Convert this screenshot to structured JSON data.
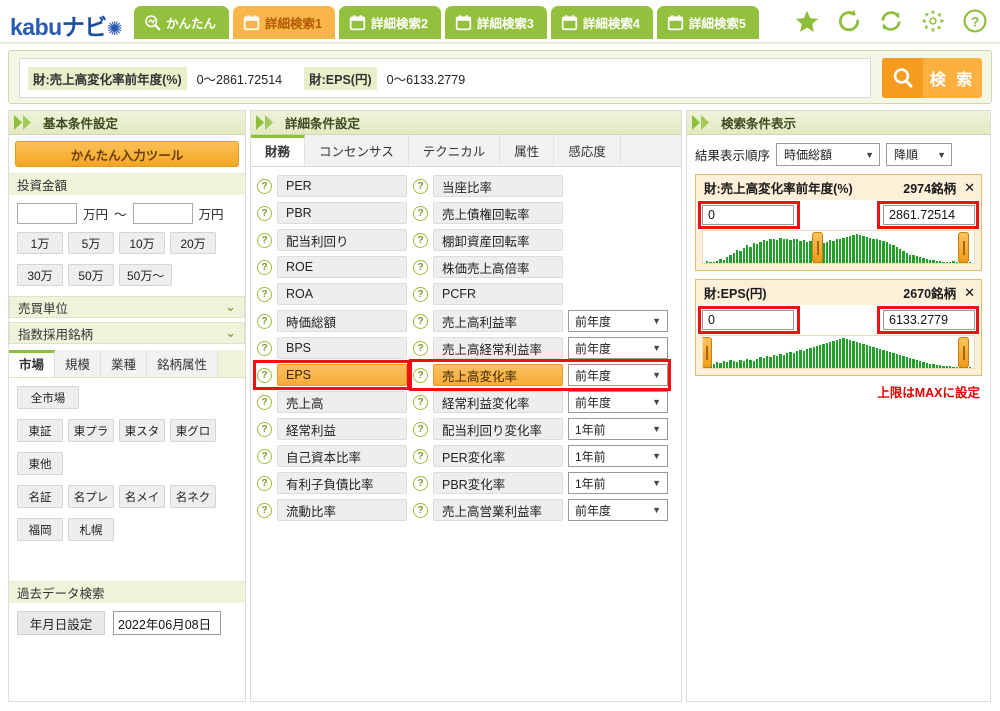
{
  "header": {
    "logo_kabu": "kabu",
    "logo_navi": "ナビ",
    "logo_mark": "✺",
    "tabs": [
      {
        "label": "かんたん",
        "icon": "search-chart-icon",
        "active": false
      },
      {
        "label": "詳細検索1",
        "icon": "calendar-icon",
        "active": true
      },
      {
        "label": "詳細検索2",
        "icon": "calendar-icon",
        "active": false
      },
      {
        "label": "詳細検索3",
        "icon": "calendar-icon",
        "active": false
      },
      {
        "label": "詳細検索4",
        "icon": "calendar-icon",
        "active": false
      },
      {
        "label": "詳細検索5",
        "icon": "calendar-icon",
        "active": false
      }
    ],
    "icons": [
      {
        "name": "star-icon",
        "glyph": "★"
      },
      {
        "name": "refresh-icon",
        "glyph": "⟳"
      },
      {
        "name": "sync-icon",
        "glyph": "⟲"
      },
      {
        "name": "gear-icon",
        "glyph": "✷"
      },
      {
        "name": "help-icon",
        "glyph": "?"
      }
    ],
    "accent_green": "#93c13d",
    "accent_orange": "#f9b648"
  },
  "searchbar": {
    "conditions": [
      {
        "chip": "財:売上高変化率前年度(%)",
        "value": "0〜2861.72514"
      },
      {
        "chip": "財:EPS(円)",
        "value": "0〜6133.2779"
      }
    ],
    "search_button": "検 索",
    "search_icon": "magnifier-icon"
  },
  "left_panel": {
    "title": "基本条件設定",
    "easy_tool_button": "かんたん入力ツール",
    "investment": {
      "label": "投資金額",
      "from_value": "",
      "to_value": "",
      "from_placeholder": "",
      "to_placeholder": "",
      "unit": "万円",
      "range_mark": "〜",
      "presets": [
        "1万",
        "5万",
        "10万",
        "20万",
        "30万",
        "50万",
        "50万〜"
      ]
    },
    "collapsibles": [
      {
        "label": "売買単位",
        "caret": "⌄"
      },
      {
        "label": "指数採用銘柄",
        "caret": "⌄"
      }
    ],
    "market_tabs": [
      {
        "label": "市場",
        "active": true
      },
      {
        "label": "規模",
        "active": false
      },
      {
        "label": "業種",
        "active": false
      },
      {
        "label": "銘柄属性",
        "active": false
      }
    ],
    "markets_row1": [
      "全市場"
    ],
    "markets_row2": [
      "東証",
      "東プラ",
      "東スタ",
      "東グロ"
    ],
    "markets_row3": [
      "東他"
    ],
    "markets_row4": [
      "名証",
      "名プレ",
      "名メイ",
      "名ネク"
    ],
    "markets_row5": [
      "福岡",
      "札幌"
    ],
    "past_data": {
      "label": "過去データ検索",
      "date_button": "年月日設定",
      "date_value": "2022年06月08日"
    }
  },
  "mid_panel": {
    "title": "詳細条件設定",
    "tabs": [
      {
        "label": "財務",
        "active": true
      },
      {
        "label": "コンセンサス",
        "active": false
      },
      {
        "label": "テクニカル",
        "active": false
      },
      {
        "label": "属性",
        "active": false
      },
      {
        "label": "感応度",
        "active": false
      }
    ],
    "column_left": [
      {
        "label": "PER",
        "selected": false
      },
      {
        "label": "PBR",
        "selected": false
      },
      {
        "label": "配当利回り",
        "selected": false
      },
      {
        "label": "ROE",
        "selected": false
      },
      {
        "label": "ROA",
        "selected": false
      },
      {
        "label": "時価総額",
        "selected": false
      },
      {
        "label": "BPS",
        "selected": false
      },
      {
        "label": "EPS",
        "selected": true
      },
      {
        "label": "売上高",
        "selected": false
      },
      {
        "label": "経常利益",
        "selected": false
      },
      {
        "label": "自己資本比率",
        "selected": false
      },
      {
        "label": "有利子負債比率",
        "selected": false
      },
      {
        "label": "流動比率",
        "selected": false
      }
    ],
    "column_right": [
      {
        "label": "当座比率",
        "selected": false,
        "period": null
      },
      {
        "label": "売上債権回転率",
        "selected": false,
        "period": null
      },
      {
        "label": "棚卸資産回転率",
        "selected": false,
        "period": null
      },
      {
        "label": "株価売上高倍率",
        "selected": false,
        "period": null
      },
      {
        "label": "PCFR",
        "selected": false,
        "period": null
      },
      {
        "label": "売上高利益率",
        "selected": false,
        "period": "前年度"
      },
      {
        "label": "売上高経常利益率",
        "selected": false,
        "period": "前年度"
      },
      {
        "label": "売上高変化率",
        "selected": true,
        "period": "前年度"
      },
      {
        "label": "経常利益変化率",
        "selected": false,
        "period": "前年度"
      },
      {
        "label": "配当利回り変化率",
        "selected": false,
        "period": "1年前"
      },
      {
        "label": "PER変化率",
        "selected": false,
        "period": "1年前"
      },
      {
        "label": "PBR変化率",
        "selected": false,
        "period": "1年前"
      },
      {
        "label": "売上高営業利益率",
        "selected": false,
        "period": "前年度"
      }
    ],
    "help_icon_glyph": "?"
  },
  "right_panel": {
    "title": "検索条件表示",
    "sort_label": "結果表示順序",
    "sort_key": "時価総額",
    "sort_order": "降順",
    "filters": [
      {
        "title": "財:売上高変化率前年度(%)",
        "count": "2974銘柄",
        "close": "✕",
        "min_value": "0",
        "max_value": "2861.72514",
        "handle_left_pct": 42,
        "handle_right_pct": 96
      },
      {
        "title": "財:EPS(円)",
        "count": "2670銘柄",
        "close": "✕",
        "min_value": "0",
        "max_value": "6133.2779",
        "handle_left_pct": 1,
        "handle_right_pct": 96
      }
    ],
    "annotation": "上限はMAXに設定",
    "annotation_color": "#e60000"
  },
  "chart_data": [
    {
      "type": "bar",
      "title": "財:売上高変化率前年度(%)",
      "xlabel": "",
      "ylabel": "",
      "categories": [],
      "values": [
        2,
        1,
        1,
        2,
        4,
        3,
        6,
        9,
        11,
        14,
        13,
        16,
        19,
        17,
        21,
        20,
        22,
        24,
        23,
        26,
        25,
        24,
        27,
        26,
        25,
        24,
        26,
        25,
        23,
        24,
        22,
        23,
        21,
        22,
        23,
        21,
        22,
        24,
        23,
        25,
        26,
        27,
        28,
        29,
        30,
        31,
        30,
        29,
        28,
        27,
        26,
        25,
        24,
        23,
        22,
        20,
        19,
        17,
        15,
        13,
        11,
        9,
        8,
        7,
        6,
        5,
        4,
        3,
        3,
        2,
        2,
        1,
        1,
        1,
        2,
        1,
        1,
        1,
        1,
        1
      ],
      "ylim": [
        0,
        34
      ]
    },
    {
      "type": "bar",
      "title": "財:EPS(円)",
      "xlabel": "",
      "ylabel": "",
      "categories": [],
      "values": [
        3,
        5,
        4,
        6,
        5,
        7,
        6,
        8,
        7,
        6,
        8,
        7,
        9,
        8,
        7,
        9,
        11,
        10,
        12,
        11,
        13,
        12,
        14,
        13,
        15,
        16,
        15,
        17,
        18,
        17,
        19,
        20,
        21,
        22,
        23,
        24,
        25,
        26,
        27,
        28,
        29,
        30,
        29,
        28,
        27,
        26,
        25,
        24,
        23,
        22,
        21,
        20,
        19,
        18,
        17,
        16,
        15,
        14,
        13,
        12,
        11,
        10,
        9,
        8,
        7,
        6,
        5,
        4,
        4,
        3,
        3,
        2,
        2,
        2,
        1,
        1,
        1,
        1,
        1,
        1
      ],
      "ylim": [
        0,
        32
      ]
    }
  ]
}
